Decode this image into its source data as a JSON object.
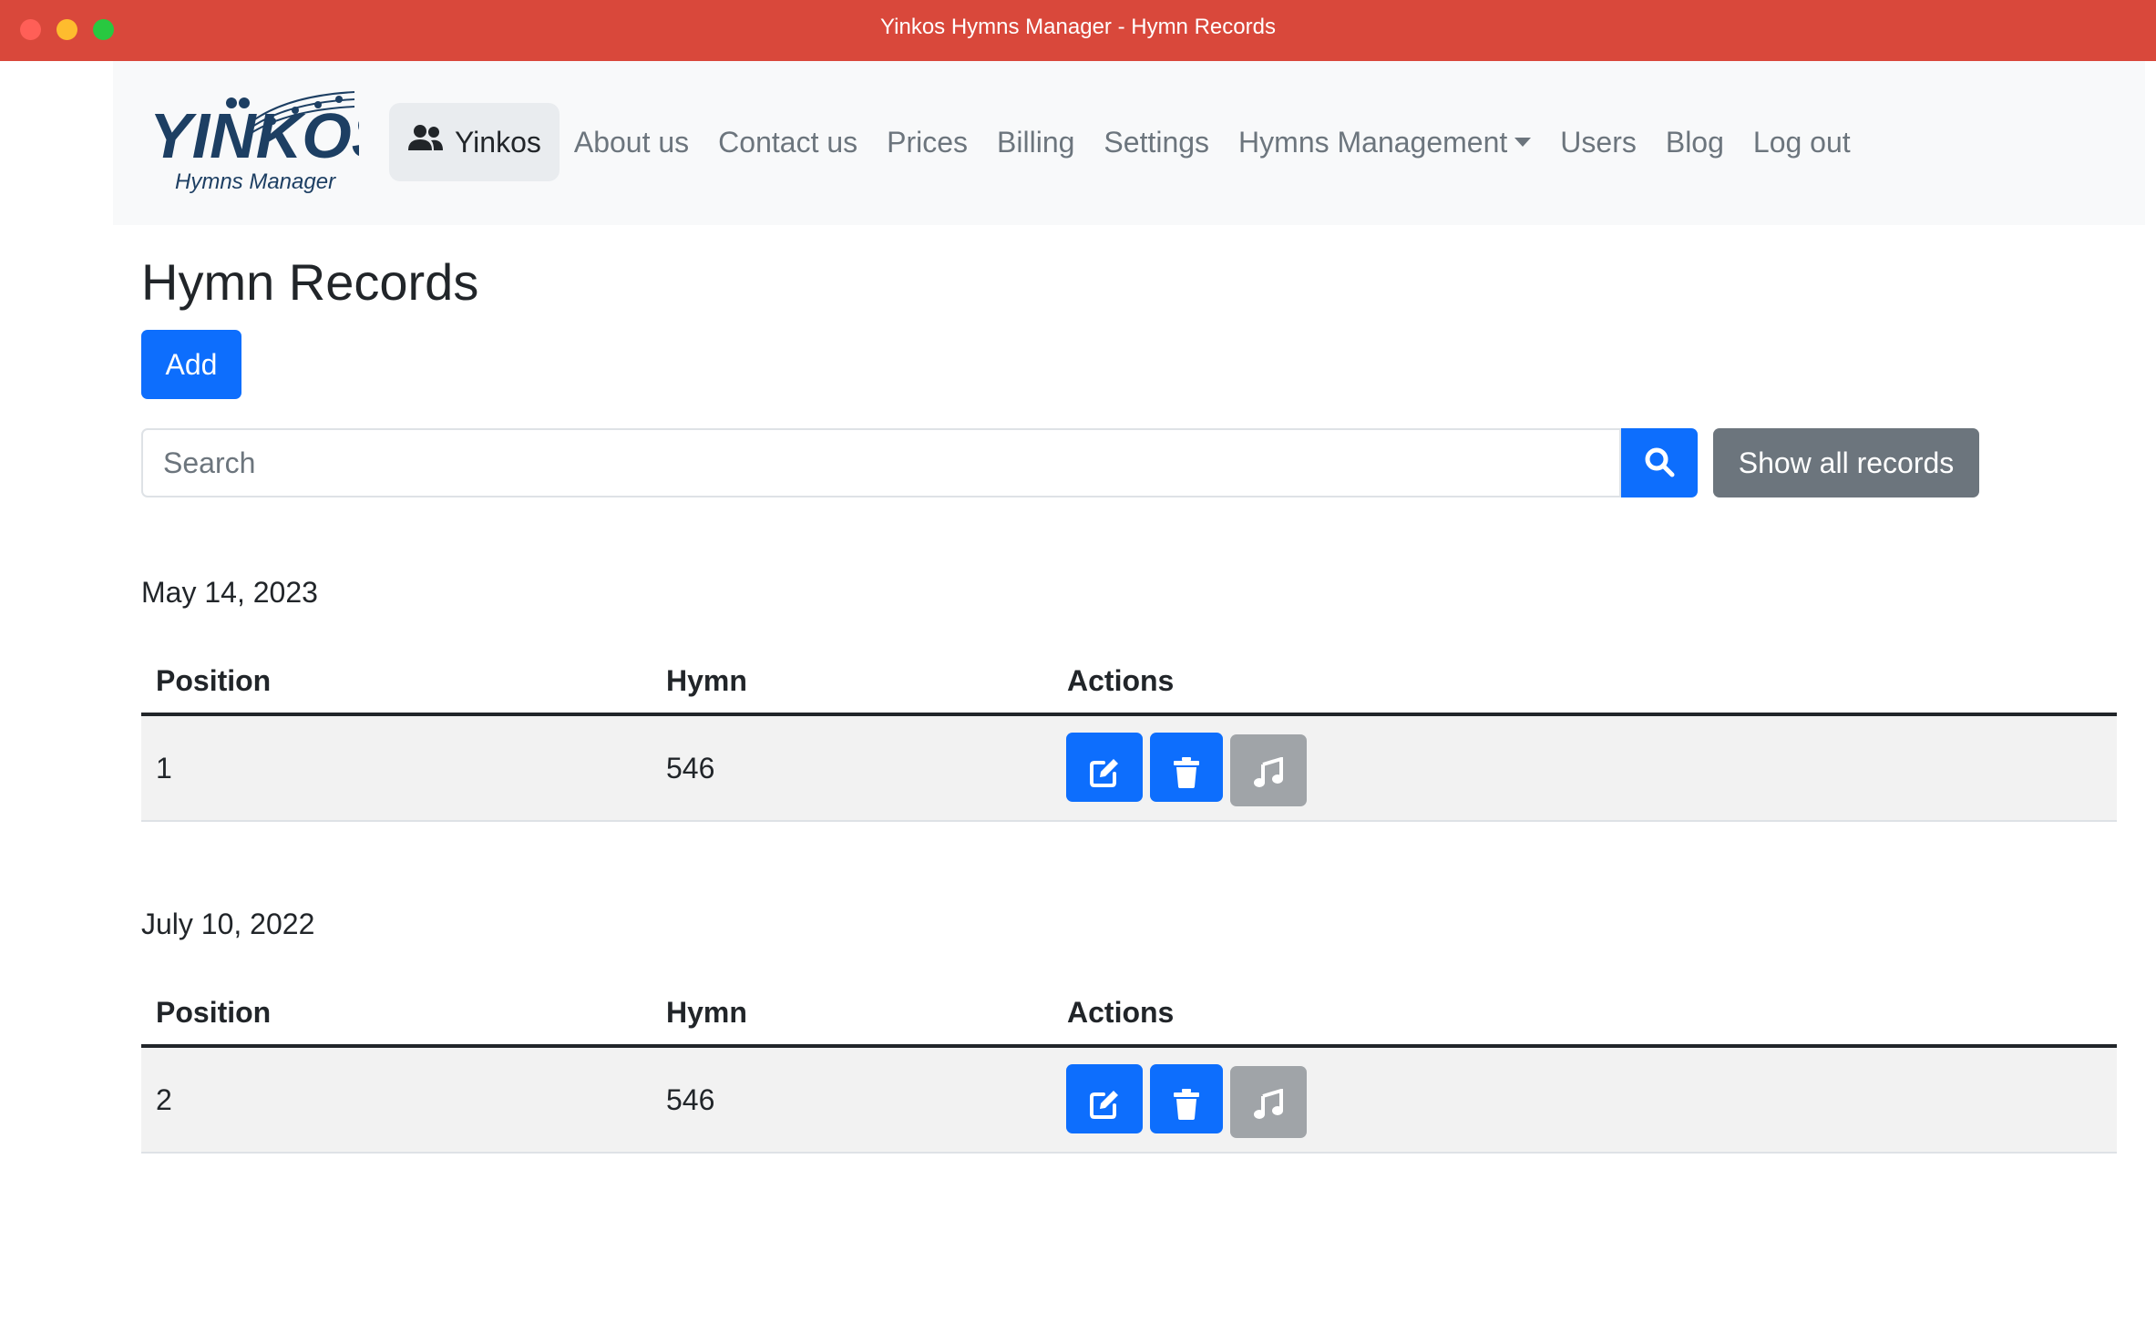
{
  "window": {
    "title": "Yinkos Hymns Manager - Hymn Records"
  },
  "logo": {
    "text_main": "YINKOS",
    "text_sub": "Hymns Manager"
  },
  "nav": {
    "brand_label": "Yinkos",
    "about": "About us",
    "contact": "Contact us",
    "prices": "Prices",
    "billing": "Billing",
    "settings": "Settings",
    "hymns_management": "Hymns Management",
    "users": "Users",
    "blog": "Blog",
    "logout": "Log out"
  },
  "page": {
    "title": "Hymn Records",
    "add_label": "Add",
    "search_placeholder": "Search",
    "show_all_label": "Show all records"
  },
  "table_headers": {
    "position": "Position",
    "hymn": "Hymn",
    "actions": "Actions"
  },
  "groups": [
    {
      "date": "May 14, 2023",
      "rows": [
        {
          "position": "1",
          "hymn": "546"
        }
      ]
    },
    {
      "date": "July 10, 2022",
      "rows": [
        {
          "position": "2",
          "hymn": "546"
        }
      ]
    }
  ],
  "icons": {
    "nav_brand": "users-icon",
    "search": "search-icon",
    "edit": "edit-icon",
    "delete": "trash-icon",
    "play": "music-note-icon"
  },
  "colors": {
    "titlebar": "#d9483b",
    "primary": "#0d6efd",
    "secondary": "#6c757d",
    "disabled": "#a0a4a8"
  }
}
